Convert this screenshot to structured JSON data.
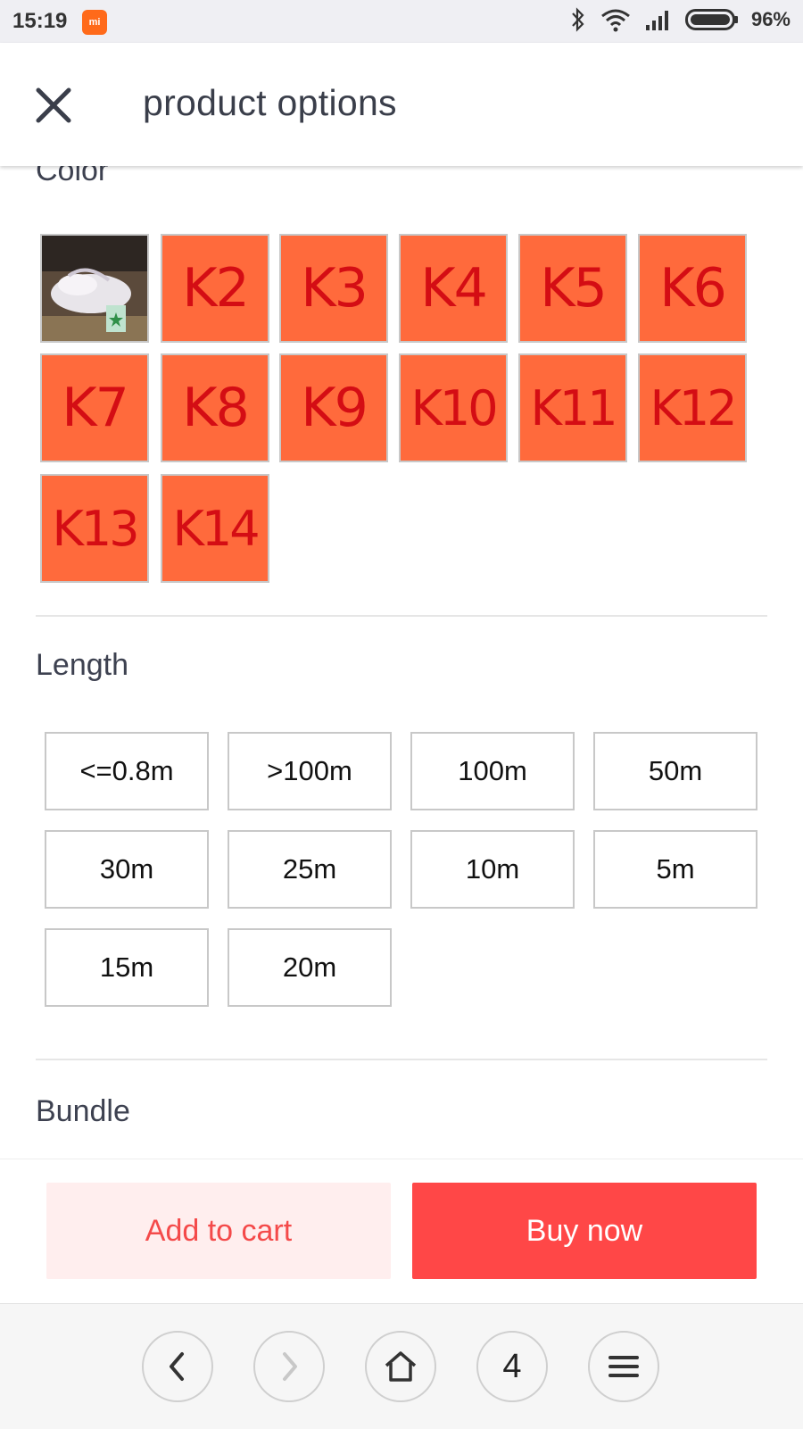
{
  "status_bar": {
    "time": "15:19",
    "mi_badge": "mi",
    "battery": "96%"
  },
  "header": {
    "title": "product options",
    "close_icon": "close-icon"
  },
  "color_section": {
    "title": "Color",
    "options": [
      "K2",
      "K3",
      "K4",
      "K5",
      "K6",
      "K7",
      "K8",
      "K9",
      "K10",
      "K11",
      "K12",
      "K13",
      "K14"
    ]
  },
  "length_section": {
    "title": "Length",
    "options": [
      "<=0.8m",
      ">100m",
      "100m",
      "50m",
      "30m",
      "25m",
      "10m",
      "5m",
      "15m",
      "20m"
    ]
  },
  "bundle_section": {
    "title": "Bundle"
  },
  "actions": {
    "add_to_cart": "Add to cart",
    "buy_now": "Buy now"
  },
  "browser_nav": {
    "tab_count": "4"
  },
  "colors": {
    "swatch": "#ff6a3c",
    "swatch_text": "#d40d14",
    "buy": "#ff4747",
    "cart_bg": "#ffeeee"
  }
}
